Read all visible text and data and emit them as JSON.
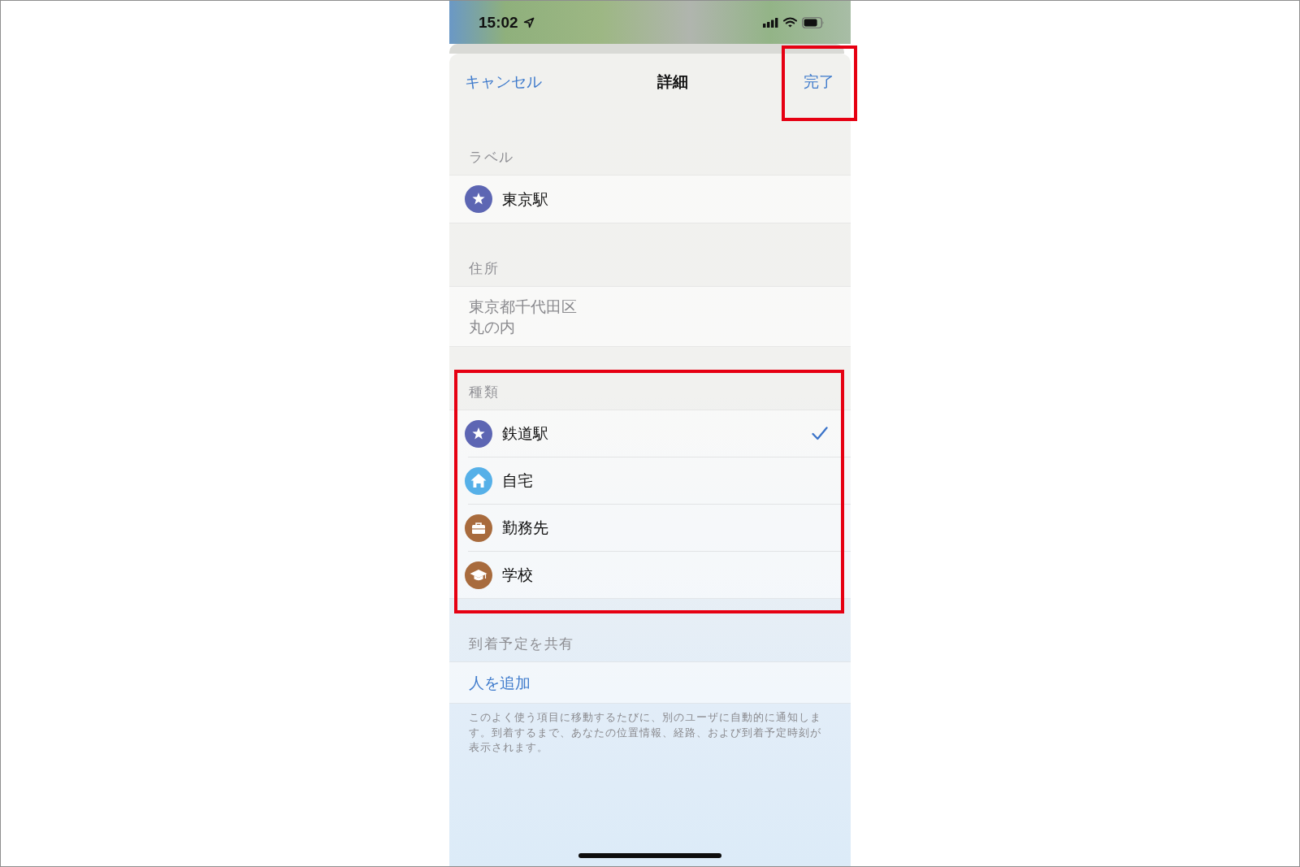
{
  "status_bar": {
    "time": "15:02"
  },
  "nav": {
    "cancel": "キャンセル",
    "title": "詳細",
    "done": {
      "label": "完了",
      "highlighted": true
    }
  },
  "label_section": {
    "header": "ラベル",
    "item": {
      "kind": "star",
      "color": "#5d66b3",
      "value": "東京駅"
    }
  },
  "address_section": {
    "header": "住所",
    "address_lines": [
      "東京都千代田区",
      "丸の内"
    ]
  },
  "type_section": {
    "header": "種類",
    "highlighted": true,
    "options": [
      {
        "kind": "star",
        "color": "#5d66b3",
        "label": "鉄道駅",
        "selected": true
      },
      {
        "kind": "house",
        "color": "#56b0e8",
        "label": "自宅",
        "selected": false
      },
      {
        "kind": "briefcase",
        "color": "#a86b3d",
        "label": "勤務先",
        "selected": false
      },
      {
        "kind": "mortarboard",
        "color": "#a86b3d",
        "label": "学校",
        "selected": false
      }
    ]
  },
  "share_section": {
    "header": "到着予定を共有",
    "action": "人を追加",
    "footer": "このよく使う項目に移動するたびに、別のユーザに自動的に通知します。到着するまで、あなたの位置情報、経路、および到着予定時刻が表示されます。"
  }
}
